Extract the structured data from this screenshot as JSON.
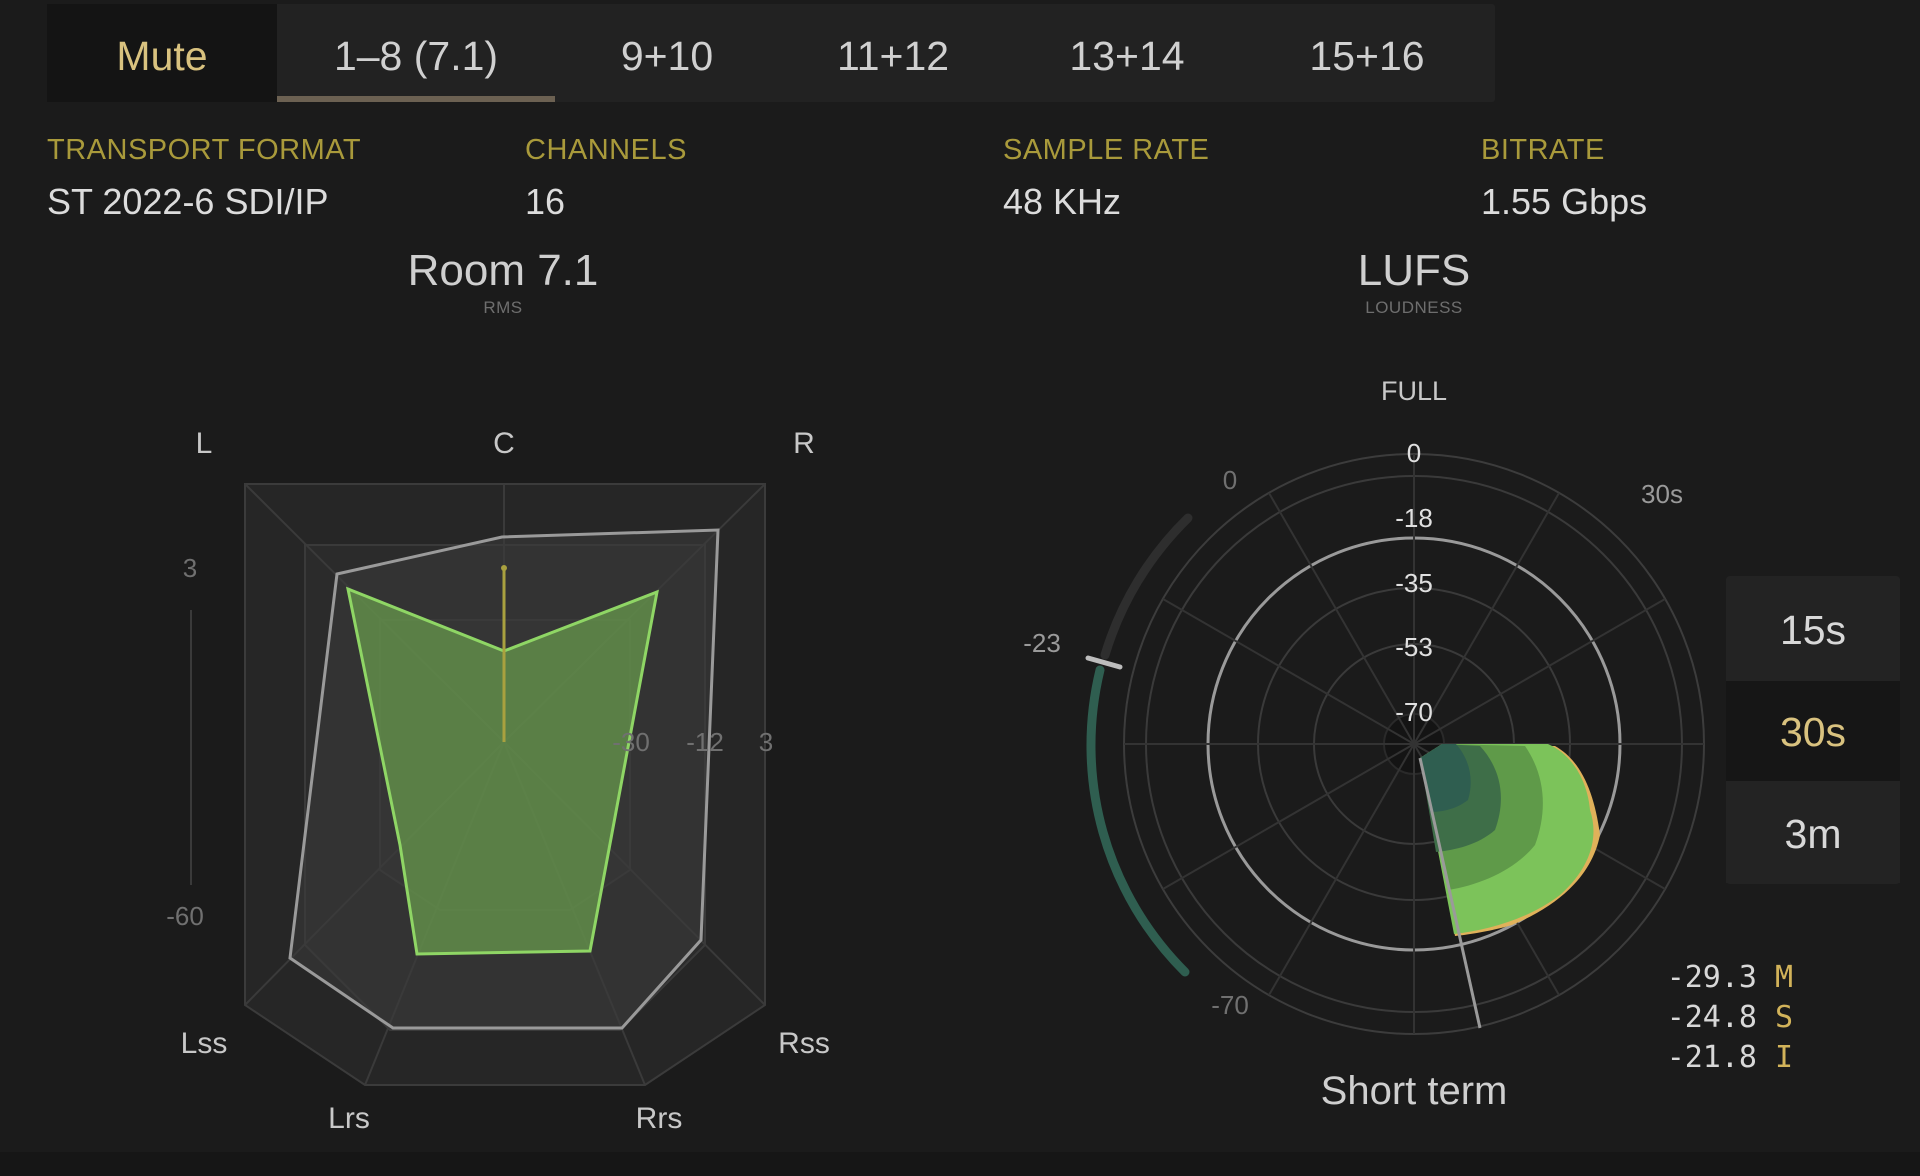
{
  "tabs": [
    {
      "label": "Mute",
      "state": "mute"
    },
    {
      "label": "1–8 (7.1)",
      "state": "selected"
    },
    {
      "label": "9+10",
      "state": "normal"
    },
    {
      "label": "11+12",
      "state": "normal"
    },
    {
      "label": "13+14",
      "state": "normal"
    },
    {
      "label": "15+16",
      "state": "normal"
    }
  ],
  "info": {
    "transport_format": {
      "label": "TRANSPORT FORMAT",
      "value": "ST 2022-6 SDI/IP"
    },
    "channels": {
      "label": "CHANNELS",
      "value": "16"
    },
    "sample_rate": {
      "label": "SAMPLE RATE",
      "value": "48 KHz"
    },
    "bitrate": {
      "label": "BITRATE",
      "value": "1.55 Gbps"
    }
  },
  "room": {
    "title": "Room 7.1",
    "subtitle": "RMS",
    "channel_labels": [
      "L",
      "C",
      "R",
      "Lss",
      "Lrs",
      "Rrs",
      "Rss"
    ],
    "scale_labels": {
      "top": "3",
      "bottom": "-60",
      "h1": "-30",
      "h2": "-12",
      "h3": "3"
    }
  },
  "lufs": {
    "title": "LUFS",
    "subtitle": "LOUDNESS",
    "mode_label": "FULL",
    "ring_labels": [
      "0",
      "-18",
      "-35",
      "-53",
      "-70"
    ],
    "outer_labels": {
      "zero": "0",
      "target": "-23",
      "min": "-70",
      "time": "30s"
    },
    "caption": "Short term",
    "time_buttons": [
      {
        "label": "15s",
        "active": false
      },
      {
        "label": "30s",
        "active": true
      },
      {
        "label": "3m",
        "active": false
      }
    ],
    "readouts": [
      {
        "value": "-29.3",
        "unit": "M"
      },
      {
        "value": "-24.8",
        "unit": "S"
      },
      {
        "value": "-21.8",
        "unit": "I"
      }
    ]
  },
  "colors": {
    "accent_gold": "#d9c27f",
    "label_olive": "#a99a3b",
    "meter_green": "#7cc35a",
    "meter_dark": "#2f5e50",
    "peak_orange": "#e0b15a"
  }
}
